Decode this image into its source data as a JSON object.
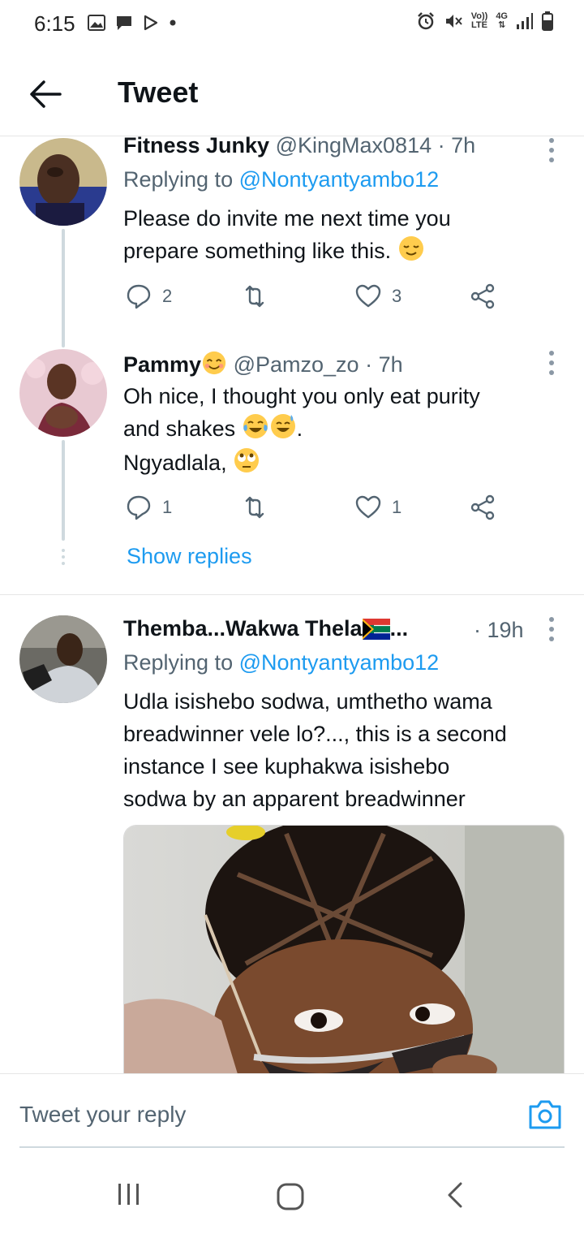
{
  "status_bar": {
    "time": "6:15",
    "network": "4G",
    "lte_top": "Vo))",
    "lte_bottom": "LTE"
  },
  "header": {
    "title": "Tweet",
    "back_icon": "arrow-left-icon"
  },
  "tweets": [
    {
      "name": "Fitness Junky",
      "handle": "@KingMax0814",
      "time": "· 7h",
      "replying_prefix": "Replying to",
      "replying_to": "@Nontyantyambo12",
      "lines": [
        "Please do invite me next time you",
        "prepare something like this."
      ],
      "replies": "2",
      "likes": "3"
    },
    {
      "name": "Pammy",
      "handle": "@Pamzo_zo",
      "time": "· 7h",
      "lines": [
        "Oh nice, I thought you only eat purity",
        "and shakes",
        "Ngyadlala,"
      ],
      "period": ".",
      "replies": "1",
      "likes": "1"
    },
    {
      "name": "Themba...Wakwa Thela",
      "ellipsis": "...",
      "time": "· 19h",
      "replying_prefix": "Replying to",
      "replying_to": "@Nontyantyambo12",
      "lines": [
        "Udla isishebo sodwa, umthetho wama",
        "breadwinner vele lo?..., this is a second",
        "instance I see kuphakwa isishebo",
        "sodwa by an apparent breadwinner"
      ]
    }
  ],
  "show_replies": "Show replies",
  "reply_bar": {
    "placeholder": "Tweet your reply"
  },
  "colors": {
    "accent": "#1d9bf0",
    "secondary_text": "#536471",
    "thread_line": "#cfd9de"
  }
}
